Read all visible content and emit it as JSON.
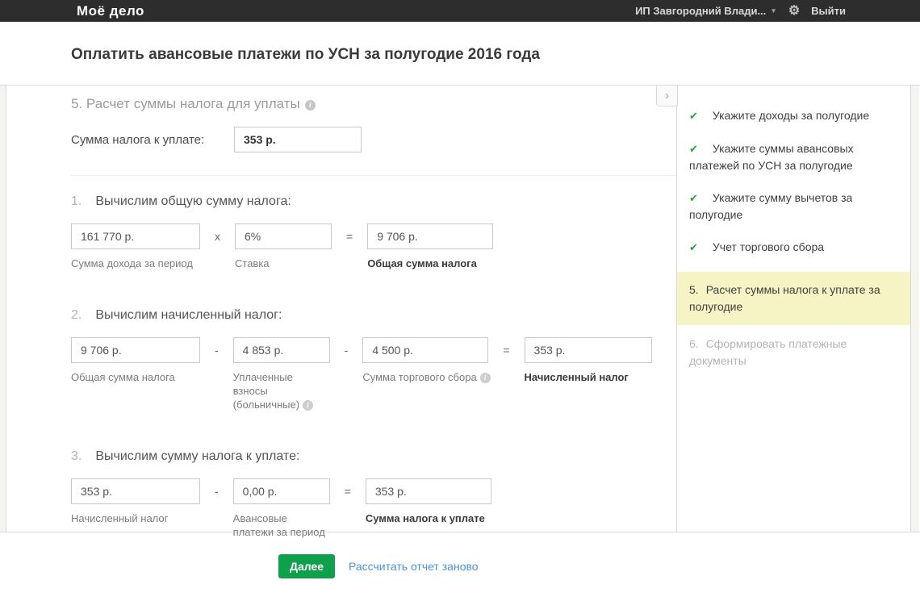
{
  "topbar": {
    "logo": "Моё дело",
    "account": "ИП Завгородний Влади...",
    "caret_icon": "▾",
    "gear_icon": "⚙",
    "logout": "Выйти"
  },
  "page": {
    "title": "Оплатить авансовые платежи по УСН за полугодие 2016 года"
  },
  "main": {
    "collapse_icon": "›",
    "section_title": "5. Расчет суммы налога для уплаты",
    "info_icon": "i",
    "summary": {
      "label": "Сумма налога к уплате:",
      "value": "353 р."
    },
    "steps": [
      {
        "number": "1.",
        "title": "Вычислим общую сумму налога:",
        "fields": [
          {
            "value": "161 770 р.",
            "label": "Сумма дохода за период"
          },
          {
            "value": "6%",
            "label": "Ставка"
          },
          {
            "value": "9 706 р.",
            "label": "Общая сумма налога"
          }
        ],
        "ops": [
          "х",
          "="
        ]
      },
      {
        "number": "2.",
        "title": "Вычислим начисленный налог:",
        "fields": [
          {
            "value": "9 706 р.",
            "label": "Общая сумма налога"
          },
          {
            "value": "4 853 р.",
            "label": "Уплаченные взносы (больничные)"
          },
          {
            "value": "4 500 р.",
            "label": "Сумма торгового сбора"
          },
          {
            "value": "353 р.",
            "label": "Начисленный налог"
          }
        ],
        "ops": [
          "-",
          "-",
          "="
        ]
      },
      {
        "number": "3.",
        "title": "Вычислим сумму налога к уплате:",
        "fields": [
          {
            "value": "353 р.",
            "label": "Начисленный налог"
          },
          {
            "value": "0,00 р.",
            "label": "Авансовые платежи за период"
          },
          {
            "value": "353 р.",
            "label": "Сумма налога к уплате"
          }
        ],
        "ops": [
          "-",
          "="
        ]
      }
    ]
  },
  "sidebar": {
    "check_icon": "✔",
    "items": [
      {
        "status": "done",
        "text": "Укажите доходы за полугодие"
      },
      {
        "status": "done",
        "text": "Укажите суммы авансовых платежей по УСН за полугодие"
      },
      {
        "status": "done",
        "text": "Укажите сумму вычетов за полугодие"
      },
      {
        "status": "done",
        "text": "Учет торгового сбора"
      },
      {
        "status": "active",
        "number": "5.",
        "text": "Расчет суммы налога к уплате за полугодие"
      },
      {
        "status": "pending",
        "number": "6.",
        "text": "Сформировать платежные документы"
      }
    ]
  },
  "footer": {
    "next_button": "Далее",
    "recalc_link": "Рассчитать отчет заново"
  },
  "colors": {
    "topbar_bg": "#2d2d2d",
    "accent_green": "#0fa04b",
    "check_green": "#21a038",
    "link_blue": "#4b94d4",
    "highlight_yellow": "#f6f3c5"
  }
}
